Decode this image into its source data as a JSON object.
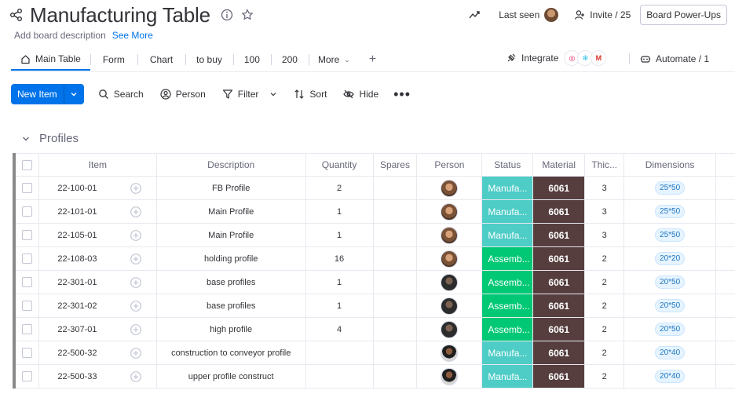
{
  "board": {
    "title": "Manufacturing Table",
    "description_placeholder": "Add board description",
    "see_more": "See More"
  },
  "header": {
    "last_seen": "Last seen",
    "invite": "Invite / 25",
    "power_ups": "Board Power-Ups"
  },
  "tabs": [
    {
      "label": "Main Table",
      "active": true
    },
    {
      "label": "Form"
    },
    {
      "label": "Chart"
    },
    {
      "label": "to buy"
    },
    {
      "label": "100"
    },
    {
      "label": "200"
    },
    {
      "label": "More"
    }
  ],
  "integrations": {
    "integrate_label": "Integrate",
    "automate_label": "Automate / 1",
    "icons": [
      "slack-icon",
      "gmail-icon",
      "outlook-icon"
    ]
  },
  "toolbar": {
    "new_item": "New Item",
    "search": "Search",
    "person": "Person",
    "filter": "Filter",
    "sort": "Sort",
    "hide": "Hide"
  },
  "group": {
    "title": "Profiles",
    "color": "#8a8a8a"
  },
  "columns": {
    "item": "Item",
    "description": "Description",
    "quantity": "Quantity",
    "spares": "Spares",
    "person": "Person",
    "status": "Status",
    "material": "Material",
    "thickness": "Thic...",
    "dimensions": "Dimensions"
  },
  "colors": {
    "status_manufacture": "#4eccc6",
    "status_assembly": "#00c875",
    "material": "#563e3e",
    "primary": "#0073ea"
  },
  "rows": [
    {
      "item": "22-100-01",
      "description": "FB Profile",
      "quantity": "2",
      "spares": "",
      "person": "avatar-a",
      "status": "Manufa...",
      "status_kind": "manufacture",
      "material": "6061",
      "thickness": "3",
      "dimensions": "25*50"
    },
    {
      "item": "22-101-01",
      "description": "Main Profile",
      "quantity": "1",
      "spares": "",
      "person": "avatar-a",
      "status": "Manufa...",
      "status_kind": "manufacture",
      "material": "6061",
      "thickness": "3",
      "dimensions": "25*50"
    },
    {
      "item": "22-105-01",
      "description": "Main Profile",
      "quantity": "1",
      "spares": "",
      "person": "avatar-a",
      "status": "Manufa...",
      "status_kind": "manufacture",
      "material": "6061",
      "thickness": "3",
      "dimensions": "25*50"
    },
    {
      "item": "22-108-03",
      "description": "holding profile",
      "quantity": "16",
      "spares": "",
      "person": "avatar-a",
      "status": "Assemb...",
      "status_kind": "assembly",
      "material": "6061",
      "thickness": "2",
      "dimensions": "20*20"
    },
    {
      "item": "22-301-01",
      "description": "base profiles",
      "quantity": "1",
      "spares": "",
      "person": "avatar-b",
      "status": "Assemb...",
      "status_kind": "assembly",
      "material": "6061",
      "thickness": "2",
      "dimensions": "20*50"
    },
    {
      "item": "22-301-02",
      "description": "base profiles",
      "quantity": "1",
      "spares": "",
      "person": "avatar-b",
      "status": "Assemb...",
      "status_kind": "assembly",
      "material": "6061",
      "thickness": "2",
      "dimensions": "20*50"
    },
    {
      "item": "22-307-01",
      "description": "high profile",
      "quantity": "4",
      "spares": "",
      "person": "avatar-b",
      "status": "Assemb...",
      "status_kind": "assembly",
      "material": "6061",
      "thickness": "2",
      "dimensions": "20*50"
    },
    {
      "item": "22-500-32",
      "description": "construction to conveyor profile",
      "quantity": "",
      "spares": "",
      "person": "avatar-c",
      "status": "Manufa...",
      "status_kind": "manufacture",
      "material": "6061",
      "thickness": "2",
      "dimensions": "20*40"
    },
    {
      "item": "22-500-33",
      "description": "upper profile construct",
      "quantity": "",
      "spares": "",
      "person": "avatar-c",
      "status": "Manufa...",
      "status_kind": "manufacture",
      "material": "6061",
      "thickness": "2",
      "dimensions": "20*40"
    }
  ]
}
